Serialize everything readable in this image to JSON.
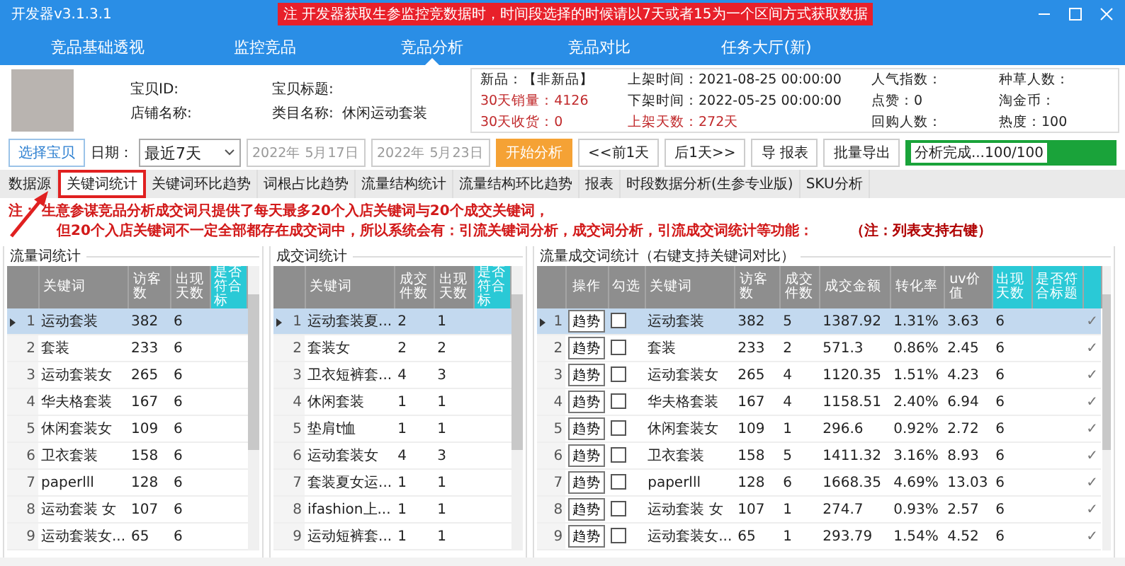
{
  "window": {
    "title": "开发器v3.1.3.1",
    "notice": "注 开发器获取生参监控竞数据时，时间段选择的时候请以7天或者15为一个区间方式获取数据"
  },
  "nav_tabs": [
    {
      "label": "竞品基础透视",
      "selected": false
    },
    {
      "label": "监控竞品",
      "selected": false
    },
    {
      "label": "竞品分析",
      "selected": true
    },
    {
      "label": "竞品对比",
      "selected": false
    },
    {
      "label": "任务大厅(新)",
      "selected": false
    }
  ],
  "product": {
    "fields": [
      {
        "label": "宝贝ID:"
      },
      {
        "label": "宝贝标题:"
      },
      {
        "label": "店铺名称:"
      },
      {
        "label": "类目名称:",
        "value": "休闲运动套装"
      }
    ],
    "stats": [
      {
        "text": "新品：【非新品】",
        "alert": false
      },
      {
        "text": "上架时间：2021-08-25 00:00:00",
        "alert": false
      },
      {
        "text": "人气指数：",
        "alert": false
      },
      {
        "text": "种草人数：",
        "alert": false
      },
      {
        "text": "30天销量：4126",
        "alert": true
      },
      {
        "text": "下架时间：2022-05-25 00:00:00",
        "alert": false
      },
      {
        "text": "点赞：0",
        "alert": false
      },
      {
        "text": "淘金币：",
        "alert": false
      },
      {
        "text": "30天收货：0",
        "alert": true
      },
      {
        "text": "上架天数：272天",
        "alert": true
      },
      {
        "text": "回购人数：",
        "alert": false
      },
      {
        "text": "热度：100",
        "alert": false
      }
    ]
  },
  "toolbar": {
    "select_button": "选择宝贝",
    "date_label": "日期：",
    "range": "最近7天",
    "start_date": "2022年  5月17日",
    "end_date": "2022年  5月23日",
    "buttons": [
      {
        "label": "开始分析",
        "kind": "primary"
      },
      {
        "label": "<<前1天",
        "kind": "normal"
      },
      {
        "label": "后1天>>",
        "kind": "normal"
      },
      {
        "label": "导 报表",
        "kind": "normal"
      },
      {
        "label": "批量导出",
        "kind": "normal"
      }
    ],
    "progress": {
      "text": "分析完成...100/100",
      "level": 1
    }
  },
  "sub_tabs": [
    {
      "label": "数据源",
      "selected": false
    },
    {
      "label": "关键词统计",
      "selected": true
    },
    {
      "label": "关键词环比趋势",
      "selected": false
    },
    {
      "label": "词根占比趋势",
      "selected": false
    },
    {
      "label": "流量结构统计",
      "selected": false
    },
    {
      "label": "流量结构环比趋势",
      "selected": false
    },
    {
      "label": "报表",
      "selected": false
    },
    {
      "label": "时段数据分析(生参专业版)",
      "selected": false
    },
    {
      "label": "SKU分析",
      "selected": false
    }
  ],
  "notes": [
    {
      "text": "注：   生意参谋竞品分析成交词只提供了每天最多20个入店关键词与20个成交关键词，",
      "kind": "text"
    },
    {
      "text": "但20个入店关键词不一定全部都存在成交词中，所以系统会有：引流关键词分析，成交词分析，引流成交词统计等功能：",
      "kind": "text"
    },
    {
      "text": "（注：列表支持右键）",
      "kind": "hint"
    }
  ],
  "tables": [
    {
      "title": "流量词统计",
      "columns": [
        {
          "label": "关键词",
          "kind": "text",
          "highlight": false
        },
        {
          "label": "访客数",
          "kind": "text",
          "highlight": false
        },
        {
          "label": "出现天数",
          "kind": "text",
          "highlight": false
        },
        {
          "label": "是否符合标",
          "kind": "text",
          "highlight": true
        }
      ],
      "rows": [
        {
          "no": "1",
          "selected": true,
          "cells": [
            "运动套装",
            "382",
            "6",
            null
          ]
        },
        {
          "no": "2",
          "selected": false,
          "cells": [
            "套装",
            "233",
            "6",
            null
          ]
        },
        {
          "no": "3",
          "selected": false,
          "cells": [
            "运动套装女",
            "265",
            "6",
            null
          ]
        },
        {
          "no": "4",
          "selected": false,
          "cells": [
            "华夫格套装",
            "167",
            "6",
            null
          ]
        },
        {
          "no": "5",
          "selected": false,
          "cells": [
            "休闲套装女",
            "109",
            "6",
            null
          ]
        },
        {
          "no": "6",
          "selected": false,
          "cells": [
            "卫衣套装",
            "158",
            "6",
            null
          ]
        },
        {
          "no": "7",
          "selected": false,
          "cells": [
            "paperlll",
            "128",
            "6",
            null
          ]
        },
        {
          "no": "8",
          "selected": false,
          "cells": [
            "运动套装 女",
            "107",
            "6",
            null
          ]
        },
        {
          "no": "9",
          "selected": false,
          "cells": [
            "运动套装女...",
            "65",
            "6",
            null
          ]
        }
      ]
    },
    {
      "title": "成交词统计",
      "columns": [
        {
          "label": "关键词",
          "kind": "text",
          "highlight": false
        },
        {
          "label": "成交件数",
          "kind": "text",
          "highlight": false
        },
        {
          "label": "出现天数",
          "kind": "text",
          "highlight": false
        },
        {
          "label": "是否符合标",
          "kind": "text",
          "highlight": true
        }
      ],
      "rows": [
        {
          "no": "1",
          "selected": true,
          "cells": [
            "运动套装夏...",
            "2",
            "1",
            null
          ]
        },
        {
          "no": "2",
          "selected": false,
          "cells": [
            "套装女",
            "2",
            "2",
            null
          ]
        },
        {
          "no": "3",
          "selected": false,
          "cells": [
            "卫衣短裤套...",
            "4",
            "3",
            null
          ]
        },
        {
          "no": "4",
          "selected": false,
          "cells": [
            "休闲套装",
            "1",
            "1",
            null
          ]
        },
        {
          "no": "5",
          "selected": false,
          "cells": [
            "垫肩t恤",
            "1",
            "1",
            null
          ]
        },
        {
          "no": "6",
          "selected": false,
          "cells": [
            "运动套装女",
            "4",
            "3",
            null
          ]
        },
        {
          "no": "7",
          "selected": false,
          "cells": [
            "套装夏女运...",
            "1",
            "1",
            null
          ]
        },
        {
          "no": "8",
          "selected": false,
          "cells": [
            "ifashion上...",
            "1",
            "1",
            null
          ]
        },
        {
          "no": "9",
          "selected": false,
          "cells": [
            "运动短裤套...",
            "1",
            "1",
            null
          ]
        }
      ]
    },
    {
      "title": "流量成交词统计（右键支持关键词对比）",
      "columns": [
        {
          "label": "操作",
          "kind": "button",
          "highlight": false
        },
        {
          "label": "勾选",
          "kind": "checkbox",
          "highlight": false
        },
        {
          "label": "关键词",
          "kind": "text",
          "highlight": false
        },
        {
          "label": "访客数",
          "kind": "text",
          "highlight": false
        },
        {
          "label": "成交件数",
          "kind": "text",
          "highlight": false
        },
        {
          "label": "成交金额",
          "kind": "text",
          "highlight": false
        },
        {
          "label": "转化率",
          "kind": "text",
          "highlight": false
        },
        {
          "label": "uv价值",
          "kind": "text",
          "highlight": false
        },
        {
          "label": "出现天数",
          "kind": "text",
          "highlight": true
        },
        {
          "label": "是否符合标题",
          "kind": "text",
          "highlight": true
        },
        {
          "kind": "text",
          "highlight": true
        }
      ],
      "rows": [
        {
          "no": "1",
          "selected": true,
          "cells": [
            "趋势",
            false,
            "运动套装",
            "382",
            "5",
            "1387.92",
            "1.31%",
            "3.63",
            "6",
            null,
            "✓"
          ]
        },
        {
          "no": "2",
          "selected": false,
          "cells": [
            "趋势",
            false,
            "套装",
            "233",
            "2",
            "571.3",
            "0.86%",
            "2.45",
            "6",
            null,
            "✓"
          ]
        },
        {
          "no": "3",
          "selected": false,
          "cells": [
            "趋势",
            false,
            "运动套装女",
            "265",
            "4",
            "1120.35",
            "1.51%",
            "4.23",
            "6",
            null,
            "✓"
          ]
        },
        {
          "no": "4",
          "selected": false,
          "cells": [
            "趋势",
            false,
            "华夫格套装",
            "167",
            "4",
            "1158.51",
            "2.40%",
            "6.94",
            "6",
            null,
            "✓"
          ]
        },
        {
          "no": "5",
          "selected": false,
          "cells": [
            "趋势",
            false,
            "休闲套装女",
            "109",
            "1",
            "296.6",
            "0.92%",
            "2.72",
            "6",
            null,
            "✓"
          ]
        },
        {
          "no": "6",
          "selected": false,
          "cells": [
            "趋势",
            false,
            "卫衣套装",
            "158",
            "5",
            "1411.32",
            "3.16%",
            "8.93",
            "6",
            null,
            "✓"
          ]
        },
        {
          "no": "7",
          "selected": false,
          "cells": [
            "趋势",
            false,
            "paperlll",
            "128",
            "6",
            "1668.35",
            "4.69%",
            "13.03",
            "6",
            null,
            "✓"
          ]
        },
        {
          "no": "8",
          "selected": false,
          "cells": [
            "趋势",
            false,
            "运动套装 女",
            "107",
            "1",
            "274.7",
            "0.93%",
            "2.57",
            "6",
            null,
            "✓"
          ]
        },
        {
          "no": "9",
          "selected": false,
          "cells": [
            "趋势",
            false,
            "运动套装女...",
            "65",
            "1",
            "293.79",
            "1.54%",
            "4.52",
            "6",
            null,
            "✓"
          ]
        }
      ]
    }
  ]
}
